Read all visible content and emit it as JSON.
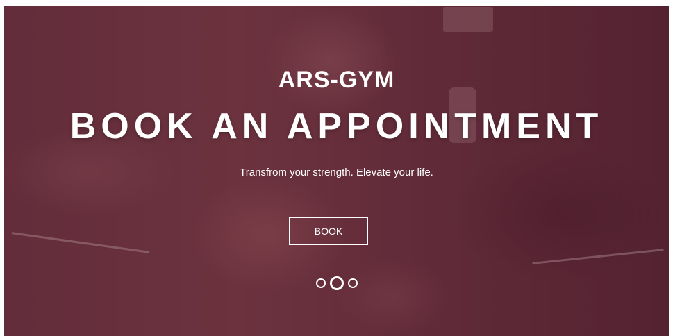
{
  "hero": {
    "brand": "ARS-GYM",
    "headline": "BOOK AN APPOINTMENT",
    "tagline": "Transfrom your strength. Elevate your life.",
    "book_label": "BOOK"
  },
  "slider": {
    "dot_count": 3,
    "active_index": 1
  },
  "colors": {
    "overlay": "#5c2434",
    "text": "#ffffff"
  },
  "icons": [
    "slider-dot-icon"
  ]
}
